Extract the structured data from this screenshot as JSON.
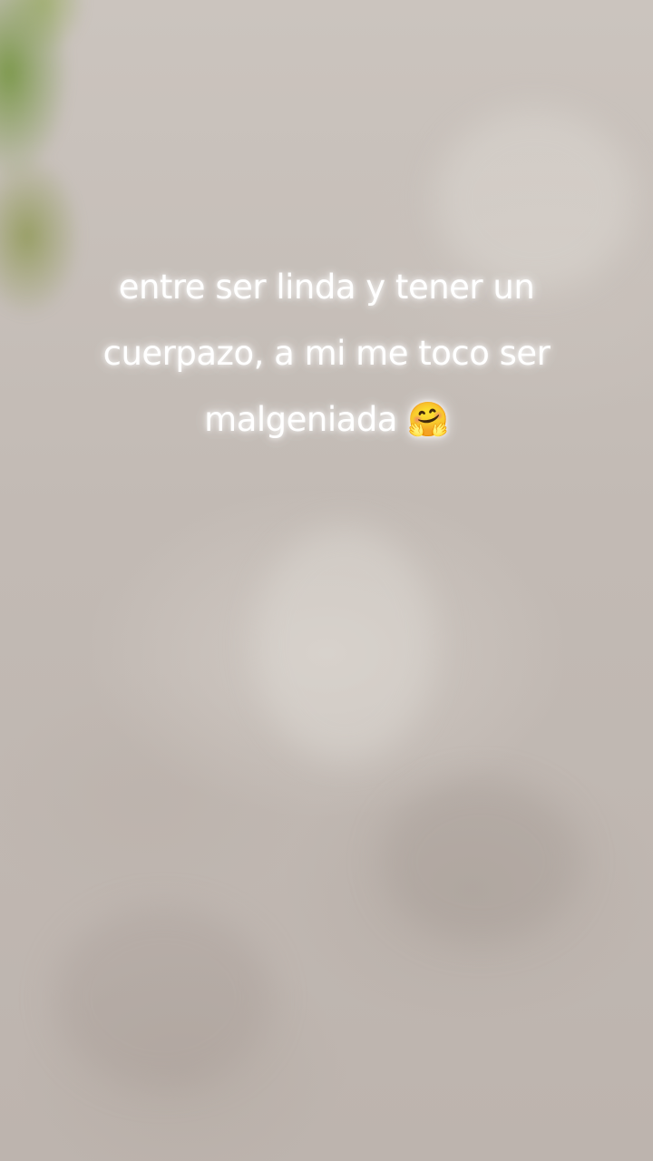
{
  "caption": {
    "line1": "entre ser linda y tener un",
    "line2": "cuerpazo, a mi me toco ser",
    "line3": "malgeniada 🤗"
  }
}
